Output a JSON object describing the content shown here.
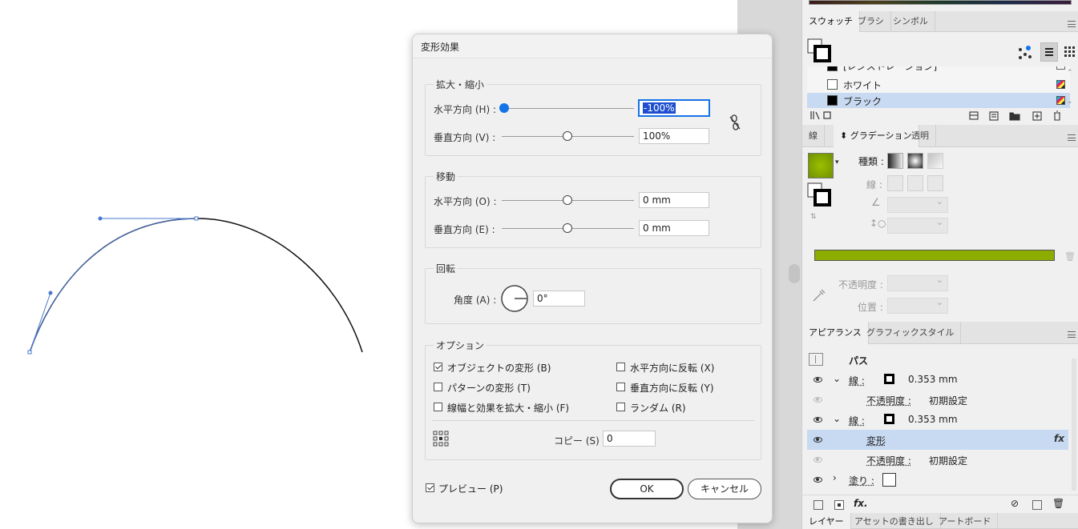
{
  "dialog": {
    "title": "変形効果",
    "scale": {
      "group_label": "拡大・縮小",
      "horizontal_label": "水平方向 (H) :",
      "horizontal_value": "-100%",
      "vertical_label": "垂直方向 (V) :",
      "vertical_value": "100%"
    },
    "move": {
      "group_label": "移動",
      "horizontal_label": "水平方向 (O) :",
      "horizontal_value": "0 mm",
      "vertical_label": "垂直方向 (E) :",
      "vertical_value": "0 mm"
    },
    "rotate": {
      "group_label": "回転",
      "angle_label": "角度 (A) :",
      "angle_value": "0°"
    },
    "options": {
      "group_label": "オプション",
      "transform_objects": "オブジェクトの変形 (B)",
      "transform_patterns": "パターンの変形 (T)",
      "scale_strokes": "線幅と効果を拡大・縮小 (F)",
      "reflect_x": "水平方向に反転 (X)",
      "reflect_y": "垂直方向に反転 (Y)",
      "random": "ランダム (R)",
      "copies_label": "コピー (S)",
      "copies_value": "0"
    },
    "preview_label": "プレビュー (P)",
    "ok_label": "OK",
    "cancel_label": "キャンセル"
  },
  "swatches": {
    "tabs": [
      "スウォッチ",
      "ブラシ",
      "シンボル"
    ],
    "items": [
      {
        "name": "[レジストレーション]",
        "color": "#000000"
      },
      {
        "name": "ホワイト",
        "color": "#ffffff"
      },
      {
        "name": "ブラック",
        "color": "#000000"
      }
    ]
  },
  "gradient": {
    "tabs": [
      "線",
      "グラデーション",
      "透明"
    ],
    "type_label": "種類 :",
    "stroke_label": "線 :",
    "opacity_label": "不透明度 :",
    "location_label": "位置 :",
    "color": "#8cac00"
  },
  "appearance": {
    "tabs": [
      "アピアランス",
      "グラフィックスタイル"
    ],
    "title": "パス",
    "rows": [
      {
        "label": "線 :",
        "value": "0.353 mm"
      },
      {
        "label": "不透明度 :",
        "value": "初期設定"
      },
      {
        "label": "線 :",
        "value": "0.353 mm"
      },
      {
        "label": "変形",
        "value": "fx"
      },
      {
        "label": "不透明度 :",
        "value": "初期設定"
      },
      {
        "label": "塗り :",
        "value": ""
      }
    ],
    "footer_fx": "fx."
  },
  "layers": {
    "tabs": [
      "レイヤー",
      "アセットの書き出し",
      "アートボード"
    ]
  }
}
